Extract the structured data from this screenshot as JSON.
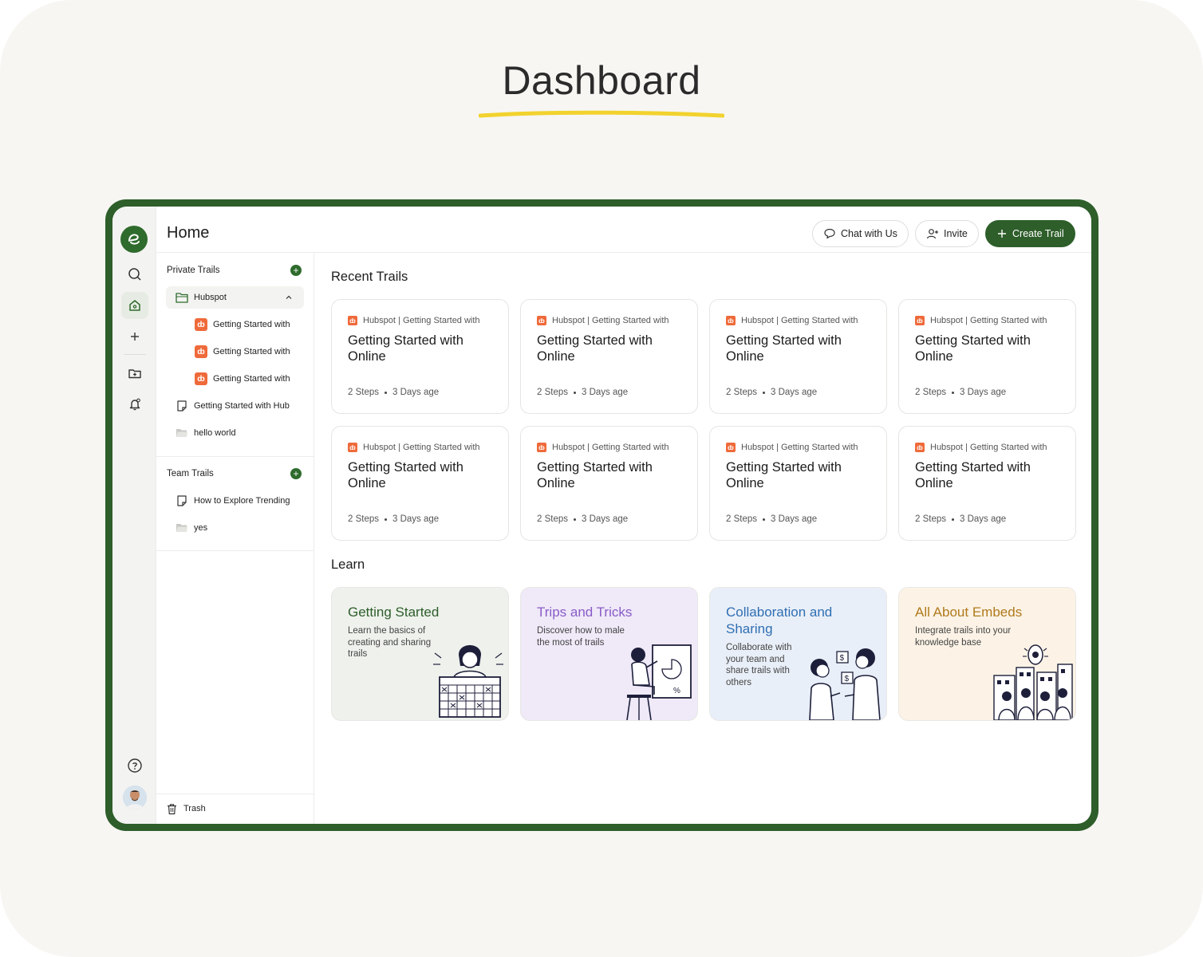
{
  "heading": "Dashboard",
  "colors": {
    "brand_green": "#2e5e2a",
    "hubspot_orange": "#ef6a3a",
    "highlight_yellow": "#f2d22e"
  },
  "header": {
    "title": "Home",
    "chat_label": "Chat with Us",
    "invite_label": "Invite",
    "create_label": "Create Trail"
  },
  "sidebar": {
    "private_title": "Private Trails",
    "private_items": [
      {
        "label": "Hubspot",
        "icon": "folder-icon"
      },
      {
        "label": "Getting Started with",
        "icon": "hubspot-icon"
      },
      {
        "label": "Getting Started with",
        "icon": "hubspot-icon"
      },
      {
        "label": "Getting Started with",
        "icon": "hubspot-icon"
      },
      {
        "label": "Getting Started with Hub",
        "icon": "document-icon"
      },
      {
        "label": "hello world",
        "icon": "folder-icon"
      }
    ],
    "team_title": "Team Trails",
    "team_items": [
      {
        "label": "How to Explore Trending",
        "icon": "document-icon"
      },
      {
        "label": "yes",
        "icon": "folder-icon"
      }
    ],
    "trash_label": "Trash"
  },
  "recent": {
    "title": "Recent Trails",
    "cards": [
      {
        "source": "Hubspot | Getting Started with",
        "title": "Getting Started with Online",
        "steps": "2 Steps",
        "age": "3 Days age"
      },
      {
        "source": "Hubspot | Getting Started with",
        "title": "Getting Started with Online",
        "steps": "2 Steps",
        "age": "3 Days age"
      },
      {
        "source": "Hubspot | Getting Started with",
        "title": "Getting Started with Online",
        "steps": "2 Steps",
        "age": "3 Days age"
      },
      {
        "source": "Hubspot | Getting Started with",
        "title": "Getting Started with Online",
        "steps": "2 Steps",
        "age": "3 Days age"
      },
      {
        "source": "Hubspot | Getting Started with",
        "title": "Getting Started with Online",
        "steps": "2 Steps",
        "age": "3 Days age"
      },
      {
        "source": "Hubspot | Getting Started with",
        "title": "Getting Started with Online",
        "steps": "2 Steps",
        "age": "3 Days age"
      },
      {
        "source": "Hubspot | Getting Started with",
        "title": "Getting Started with Online",
        "steps": "2 Steps",
        "age": "3 Days age"
      },
      {
        "source": "Hubspot | Getting Started with",
        "title": "Getting Started with Online",
        "steps": "2 Steps",
        "age": "3 Days age"
      }
    ]
  },
  "learn": {
    "title": "Learn",
    "cards": [
      {
        "title": "Getting Started",
        "desc": "Learn the basics of creating and sharing trails",
        "bg": "#eef1ec",
        "color": "#2e5e2a"
      },
      {
        "title": "Trips and Tricks",
        "desc": "Discover how to male the most of trails",
        "bg": "#efe9f8",
        "color": "#8a5cc7"
      },
      {
        "title": "Collaboration and Sharing",
        "desc": "Collaborate with your team and share trails with others",
        "bg": "#e9eff8",
        "color": "#2f6fb3"
      },
      {
        "title": "All About Embeds",
        "desc": "Integrate trails into your knowledge base",
        "bg": "#fcf3e6",
        "color": "#b07a1c"
      }
    ]
  }
}
